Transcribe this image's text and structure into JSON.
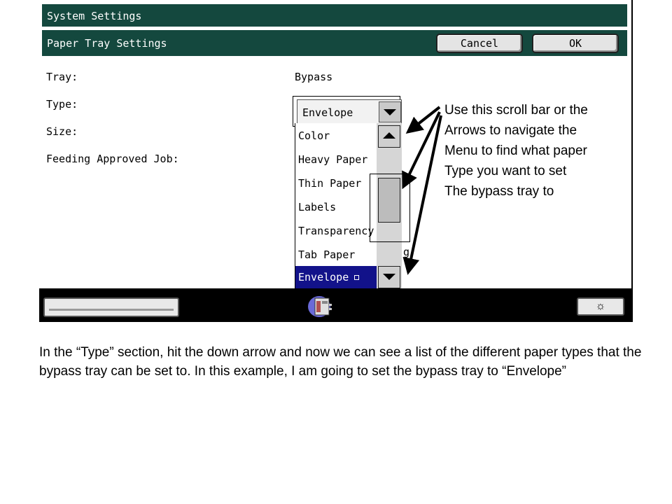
{
  "window": {
    "title": "System Settings",
    "subtitle": "Paper Tray Settings",
    "cancel_label": "Cancel",
    "ok_label": "OK"
  },
  "fields": {
    "tray_label": "Tray:",
    "tray_value": "Bypass",
    "type_label": "Type:",
    "type_value": "Envelope",
    "size_label": "Size:",
    "feeding_label": "Feeding Approved Job:"
  },
  "dropdown": {
    "items": [
      "Color",
      "Heavy Paper",
      "Thin Paper",
      "Labels",
      "Transparency",
      "Tab Paper",
      "Envelope"
    ],
    "selected_index": 6,
    "partial_text": "g"
  },
  "bottom": {
    "right_icon": "sun-brightness-icon",
    "center_icon": "printer-icon"
  },
  "callout": {
    "lines": [
      "Use this scroll bar or the",
      "Arrows to navigate the",
      "Menu to find what paper",
      "Type you want to set",
      "The bypass tray to"
    ]
  },
  "paragraph": {
    "text": "In the “Type” section, hit the down arrow and now we can see a list of the different paper types that the bypass tray can be set to. In this example, I am going to set the bypass tray to “Envelope”"
  },
  "colors": {
    "title_bar": "#14483e",
    "selected_item": "#12128a"
  }
}
